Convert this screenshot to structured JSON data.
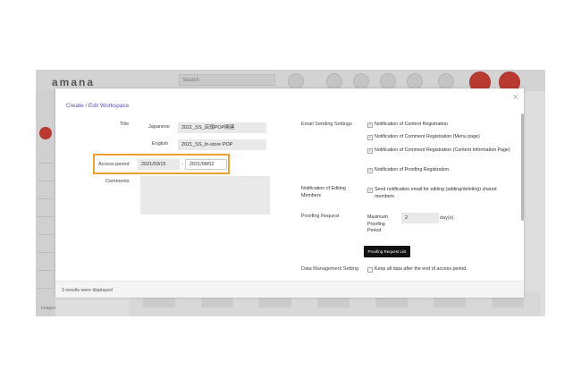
{
  "app": {
    "logo": "amana",
    "search_placeholder": "Search",
    "status_text": "Images"
  },
  "modal": {
    "title": "Create / Edit Workspace",
    "close_icon": "close-icon",
    "title_label": "Title",
    "japanese_label": "Japanese",
    "japanese_value": "2021_SS_店頭POP関連",
    "english_label": "English",
    "english_value": "2021_SS_In-store POP",
    "access_period_label": "Access period",
    "access_start": "2021/03/15",
    "access_separator": "-",
    "access_end": "2021/08/02",
    "comments_label": "Comments",
    "email_settings_label": "Email Sending Settings",
    "email_options": [
      {
        "label": "Notification of Content Registration",
        "checked": true
      },
      {
        "label": "Notification of Comment Registration (Menu page)",
        "checked": true
      },
      {
        "label": "Notification of Comment Registration (Content Information Page)",
        "checked": true
      },
      {
        "label": "Notification of Proofing Registration",
        "checked": true
      }
    ],
    "editing_members_label": "Notification of Editing Members",
    "editing_members_option": "Send notification email for editing (adding/deleting) shared members",
    "proofing_request_label": "Proofing Request",
    "max_proofing_label": "Maximum Proofing Period",
    "max_proofing_value": "2",
    "max_proofing_unit": "day(s)",
    "proofing_request_list_button": "Proofing Request List",
    "data_management_label": "Data Management Setting",
    "data_management_option": "Keep all data after the end of access period.",
    "results_text": "3 results were displayed"
  },
  "colors": {
    "highlight": "#f0a030",
    "title_accent": "#5a4fc2",
    "app_red": "#b93a30"
  }
}
